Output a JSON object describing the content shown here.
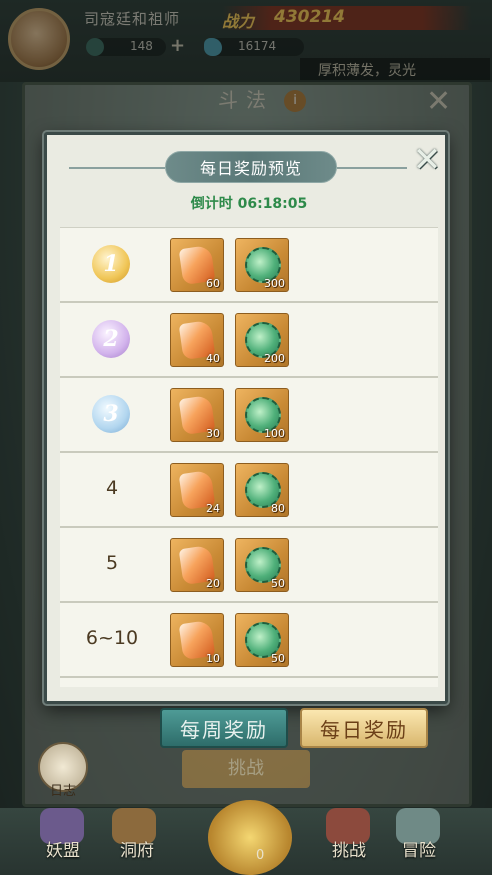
{
  "header": {
    "player_name": "司寇廷和祖师",
    "power_label": "战力",
    "power_value": "430214",
    "stamina": "148",
    "currency": "16174",
    "motto": "厚积薄发，灵光"
  },
  "background_panel": {
    "title": "斗法",
    "info_icon": "info-icon"
  },
  "modal": {
    "title": "每日奖励预览",
    "countdown": "倒计时 06:18:05",
    "rows": [
      {
        "rank": "1",
        "items": [
          {
            "icon": "fire-gem-icon",
            "qty": "60"
          },
          {
            "icon": "jade-coil-icon",
            "qty": "300"
          }
        ]
      },
      {
        "rank": "2",
        "items": [
          {
            "icon": "fire-gem-icon",
            "qty": "40"
          },
          {
            "icon": "jade-coil-icon",
            "qty": "200"
          }
        ]
      },
      {
        "rank": "3",
        "items": [
          {
            "icon": "fire-gem-icon",
            "qty": "30"
          },
          {
            "icon": "jade-coil-icon",
            "qty": "100"
          }
        ]
      },
      {
        "rank": "4",
        "items": [
          {
            "icon": "fire-gem-icon",
            "qty": "24"
          },
          {
            "icon": "jade-coil-icon",
            "qty": "80"
          }
        ]
      },
      {
        "rank": "5",
        "items": [
          {
            "icon": "fire-gem-icon",
            "qty": "20"
          },
          {
            "icon": "jade-coil-icon",
            "qty": "50"
          }
        ]
      },
      {
        "rank": "6~10",
        "items": [
          {
            "icon": "fire-gem-icon",
            "qty": "10"
          },
          {
            "icon": "jade-coil-icon",
            "qty": "50"
          }
        ]
      }
    ]
  },
  "tabs": {
    "weekly": "每周奖励",
    "daily": "每日奖励"
  },
  "journal": "日志",
  "challenge": "挑战",
  "bottom_nav": {
    "item1": "妖盟",
    "item2": "洞府",
    "center_count": "0",
    "item4": "挑战",
    "item5": "冒险"
  },
  "colors": {
    "countdown": "#2e8a4a",
    "daily_tab": "#d9b76f",
    "weekly_tab": "#2e6d6a"
  }
}
